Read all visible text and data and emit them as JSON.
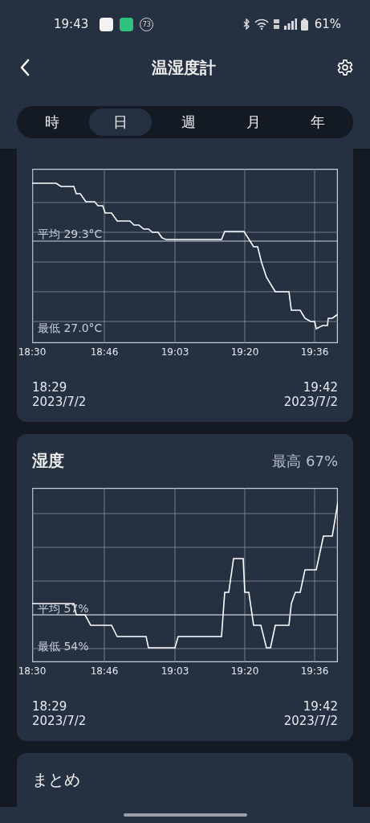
{
  "status_bar": {
    "time": "19:43",
    "badge": "73",
    "battery": "61%"
  },
  "app_bar": {
    "title": "温湿度計"
  },
  "tabs": [
    {
      "label": "時",
      "selected": false
    },
    {
      "label": "日",
      "selected": true
    },
    {
      "label": "週",
      "selected": false
    },
    {
      "label": "月",
      "selected": false
    },
    {
      "label": "年",
      "selected": false
    }
  ],
  "cards": [
    {
      "kind": "temperature",
      "average": "平均 29.3°C",
      "minimum": "最低 27.0°C",
      "xticks": [
        "18:30",
        "18:46",
        "19:03",
        "19:20",
        "19:36"
      ],
      "start_time": "18:29",
      "start_date": "2023/7/2",
      "end_time": "19:42",
      "end_date": "2023/7/2"
    },
    {
      "kind": "humidity",
      "title": "湿度",
      "maximum": "最高 67%",
      "average": "平均 57%",
      "minimum": "最低 54%",
      "xticks": [
        "18:30",
        "18:46",
        "19:03",
        "19:20",
        "19:36"
      ],
      "start_time": "18:29",
      "start_date": "2023/7/2",
      "end_time": "19:42",
      "end_date": "2023/7/2"
    }
  ],
  "summary": {
    "title": "まとめ"
  }
}
